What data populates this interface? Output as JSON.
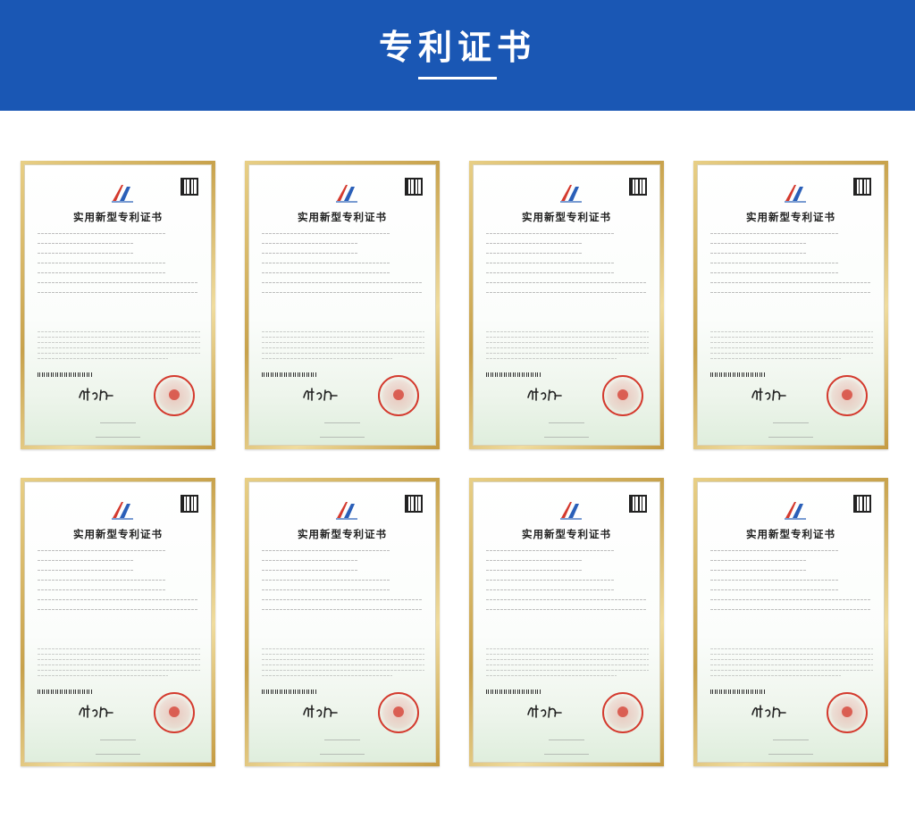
{
  "header": {
    "title": "专利证书",
    "background_color": "#1a57b4"
  },
  "certificates": [
    {
      "heading": "实用新型专利证书",
      "icon": "patent-emblem-icon",
      "seal_color": "#d43a2e"
    },
    {
      "heading": "实用新型专利证书",
      "icon": "patent-emblem-icon",
      "seal_color": "#d43a2e"
    },
    {
      "heading": "实用新型专利证书",
      "icon": "patent-emblem-icon",
      "seal_color": "#d43a2e"
    },
    {
      "heading": "实用新型专利证书",
      "icon": "patent-emblem-icon",
      "seal_color": "#d43a2e"
    },
    {
      "heading": "实用新型专利证书",
      "icon": "patent-emblem-icon",
      "seal_color": "#d43a2e"
    },
    {
      "heading": "实用新型专利证书",
      "icon": "patent-emblem-icon",
      "seal_color": "#d43a2e"
    },
    {
      "heading": "实用新型专利证书",
      "icon": "patent-emblem-icon",
      "seal_color": "#d43a2e"
    },
    {
      "heading": "实用新型专利证书",
      "icon": "patent-emblem-icon",
      "seal_color": "#d43a2e"
    }
  ]
}
